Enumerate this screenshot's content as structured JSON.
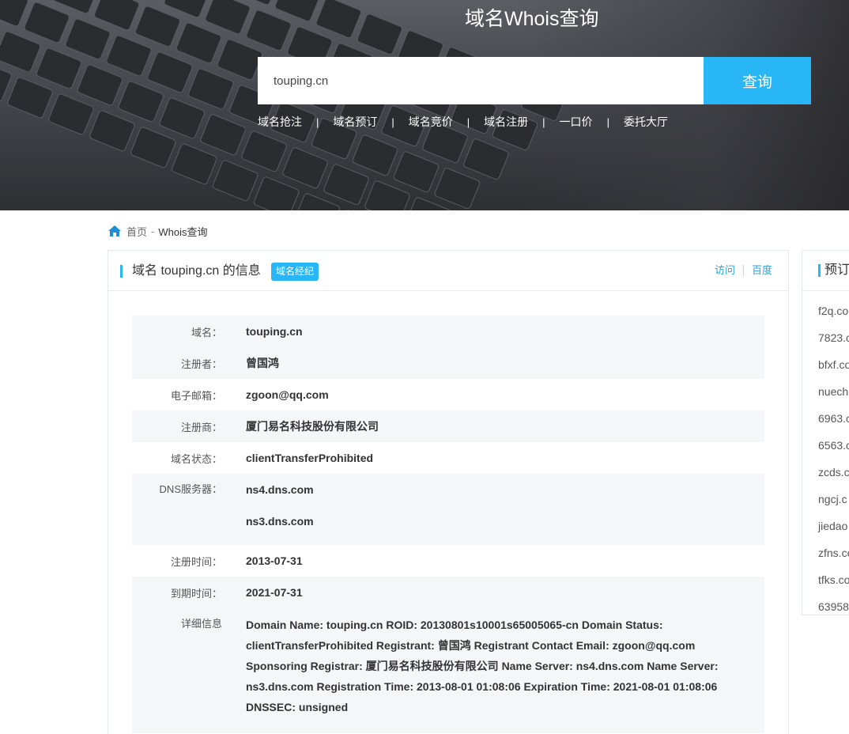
{
  "hero": {
    "title": "域名Whois查询",
    "search_value": "touping.cn",
    "search_button": "查询",
    "links": [
      "域名抢注",
      "域名预订",
      "域名竞价",
      "域名注册",
      "一口价",
      "委托大厅"
    ]
  },
  "breadcrumb": {
    "home": "首页",
    "separator": "-",
    "current": "Whois查询"
  },
  "panel": {
    "title": "域名 touping.cn 的信息",
    "badge": "域名经纪",
    "link_visit": "访问",
    "link_baidu": "百度"
  },
  "info": {
    "domain_label": "域名：",
    "domain": "touping.cn",
    "registrant_label": "注册者：",
    "registrant": "曾国鸿",
    "email_label": "电子邮箱：",
    "email": "zgoon@qq.com",
    "registrar_label": "注册商：",
    "registrar": "厦门易名科技股份有限公司",
    "status_label": "域名状态：",
    "status": "clientTransferProhibited",
    "dns_label": "DNS服务器：",
    "dns": [
      "ns4.dns.com",
      "ns3.dns.com"
    ],
    "reg_time_label": "注册时间：",
    "reg_time": "2013-07-31",
    "exp_time_label": "到期时间：",
    "exp_time": "2021-07-31",
    "detail_label": "详细信息",
    "detail": "Domain Name: touping.cn ROID: 20130801s10001s65005065-cn Domain Status: clientTransferProhibited Registrant: 曾国鸿 Registrant Contact Email: zgoon@qq.com Sponsoring Registrar: 厦门易名科技股份有限公司 Name Server: ns4.dns.com Name Server: ns3.dns.com Registration Time: 2013-08-01 01:08:06 Expiration Time: 2021-08-01 01:08:06 DNSSEC: unsigned"
  },
  "sidebar": {
    "title": "预订",
    "items": [
      "f2q.co",
      "7823.c",
      "bfxf.co",
      "nuech",
      "6963.c",
      "6563.c",
      "zcds.c",
      "ngcj.c",
      "jiedao",
      "zfns.co",
      "tfks.co",
      "63958"
    ]
  },
  "colors": {
    "accent": "#29b6f6",
    "link": "#29a3e0",
    "row_shade": "#f4f6f7"
  }
}
